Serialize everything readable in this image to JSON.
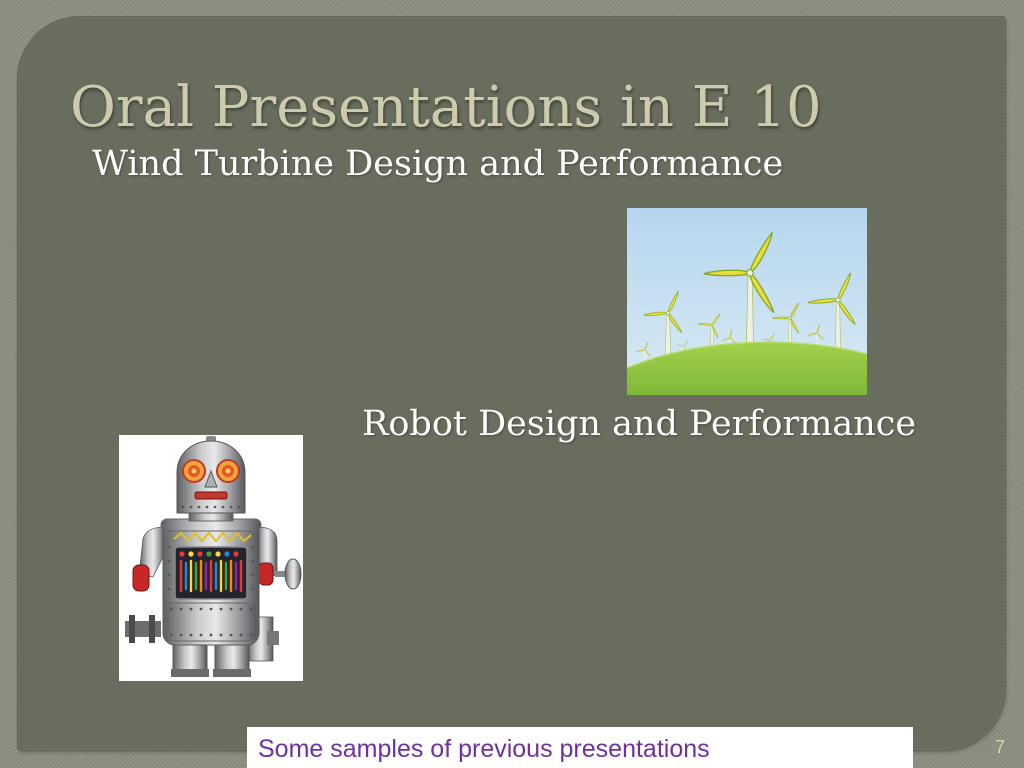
{
  "slide": {
    "title": "Oral Presentations in E 10",
    "topic_1": "Wind Turbine Design and Performance",
    "topic_2": "Robot Design and Performance",
    "footer_note": "Some samples of previous presentations",
    "page_number": "7"
  },
  "theme": {
    "frame": "#8c8f7f",
    "panel": "#696d5d",
    "title": "#cdcbac",
    "body_text": "#ffffff",
    "footer_bg": "#ffffff",
    "footer_text": "#7030a0",
    "page_number": "#d6d3bb"
  }
}
